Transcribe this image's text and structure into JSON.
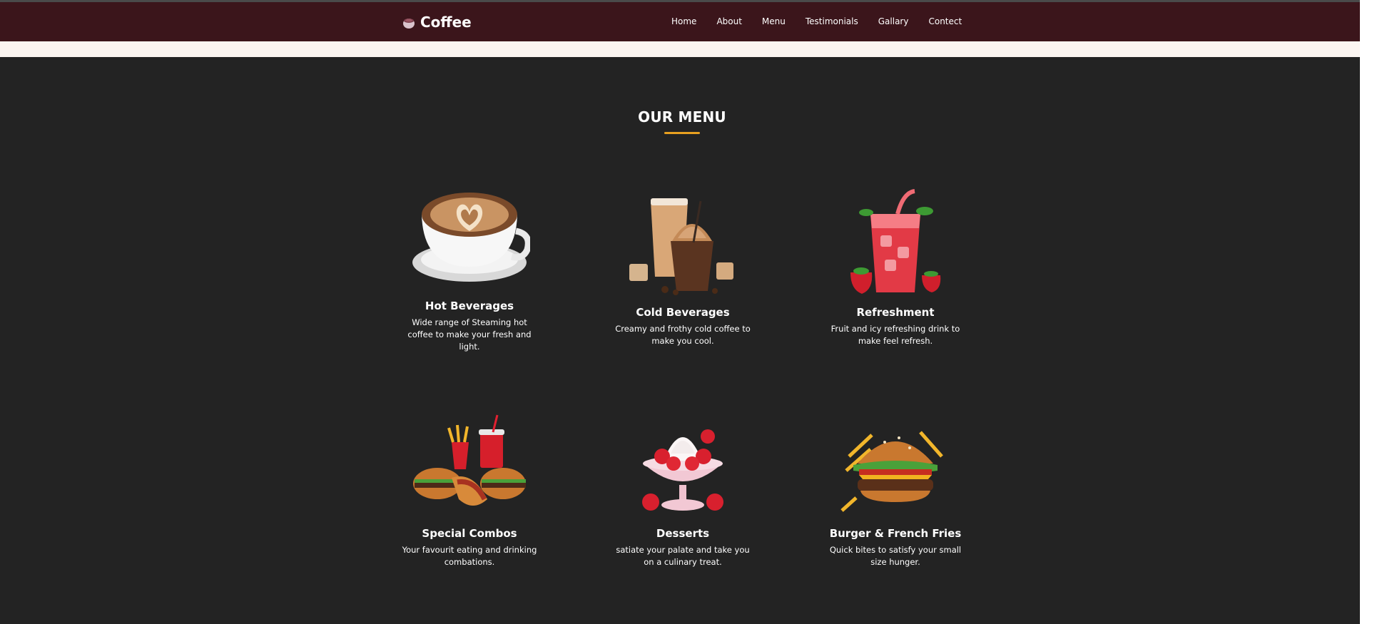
{
  "header": {
    "brand": "Coffee",
    "nav": [
      "Home",
      "About",
      "Menu",
      "Testimonials",
      "Gallary",
      "Contect"
    ]
  },
  "menu": {
    "title": "OUR MENU",
    "items": [
      {
        "title": "Hot Beverages",
        "desc": "Wide range of Steaming hot coffee to make your fresh and light.",
        "icon": "coffee-cup-icon"
      },
      {
        "title": "Cold Beverages",
        "desc": "Creamy and frothy cold coffee to make you cool.",
        "icon": "iced-coffee-icon"
      },
      {
        "title": "Refreshment",
        "desc": "Fruit and icy refreshing drink to make feel refresh.",
        "icon": "strawberry-drink-icon"
      },
      {
        "title": "Special Combos",
        "desc": "Your favourit eating and drinking combations.",
        "icon": "combo-meal-icon"
      },
      {
        "title": "Desserts",
        "desc": "satiate your palate and take you on a culinary treat.",
        "icon": "sundae-icon"
      },
      {
        "title": "Burger & French Fries",
        "desc": "Quick bites to satisfy your small size hunger.",
        "icon": "burger-icon"
      }
    ]
  },
  "colors": {
    "navbar": "#3b151b",
    "section_bg": "#232323",
    "accent": "#e8a020"
  }
}
